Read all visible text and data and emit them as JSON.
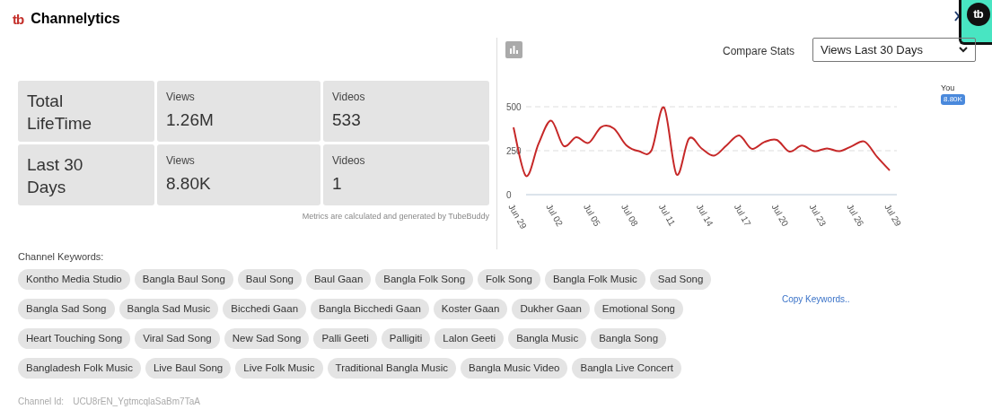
{
  "header": {
    "logo_text": "tb",
    "title": "Channelytics"
  },
  "extension_badge": {
    "logo_text": "tb"
  },
  "stats": [
    {
      "period": "Total LifeTime",
      "metrics": [
        {
          "label": "Views",
          "value": "1.26M"
        },
        {
          "label": "Videos",
          "value": "533"
        }
      ]
    },
    {
      "period": "Last 30 Days",
      "metrics": [
        {
          "label": "Views",
          "value": "8.80K"
        },
        {
          "label": "Videos",
          "value": "1"
        }
      ]
    }
  ],
  "stats_note": "Metrics are calculated and generated by TubeBuddy",
  "compare": {
    "label": "Compare Stats",
    "value": "Views Last 30 Days"
  },
  "legend": {
    "value": "8.80K",
    "color": "#4a89dc"
  },
  "chart_data": {
    "type": "line",
    "categories": [
      "Jun 29",
      null,
      null,
      "Jul 02",
      null,
      null,
      "Jul 05",
      null,
      null,
      "Jul 08",
      null,
      null,
      "Jul 11",
      null,
      null,
      "Jul 14",
      null,
      null,
      "Jul 17",
      null,
      null,
      "Jul 20",
      null,
      null,
      "Jul 23",
      null,
      null,
      "Jul 26",
      null,
      null,
      "Jul 29"
    ],
    "series": [
      {
        "name": "You",
        "color": "#c62828",
        "values": [
          383,
          106,
          290,
          421,
          277,
          326,
          295,
          385,
          376,
          281,
          247,
          251,
          496,
          115,
          319,
          263,
          222,
          281,
          337,
          261,
          299,
          311,
          245,
          279,
          247,
          263,
          247,
          276,
          302,
          215,
          138
        ]
      }
    ],
    "ylim": [
      0,
      500
    ],
    "yticks": [
      0,
      250,
      500
    ]
  },
  "keywords_label": "Channel Keywords:",
  "keyword_rows": [
    [
      "Kontho Media Studio",
      "Bangla Baul Song",
      "Baul Song",
      "Baul Gaan",
      "Bangla Folk Song",
      "Folk Song",
      "Bangla Folk Music",
      "Sad Song"
    ],
    [
      "Bangla Sad Song",
      "Bangla Sad Music",
      "Bicchedi Gaan",
      "Bangla Bicchedi Gaan",
      "Koster Gaan",
      "Dukher Gaan",
      "Emotional Song"
    ],
    [
      "Heart Touching Song",
      "Viral Sad Song",
      "New Sad Song",
      "Palli Geeti",
      "Palligiti",
      "Lalon Geeti",
      "Bangla Music",
      "Bangla Song"
    ],
    [
      "Bangladesh Folk Music",
      "Live Baul Song",
      "Live Folk Music",
      "Traditional Bangla Music",
      "Bangla Music Video",
      "Bangla Live Concert"
    ]
  ],
  "copy_keywords": "Copy Keywords..",
  "channel_id": {
    "label": "Channel Id:",
    "value": "UCU8rEN_YgtmcqlaSaBm7TaA"
  }
}
